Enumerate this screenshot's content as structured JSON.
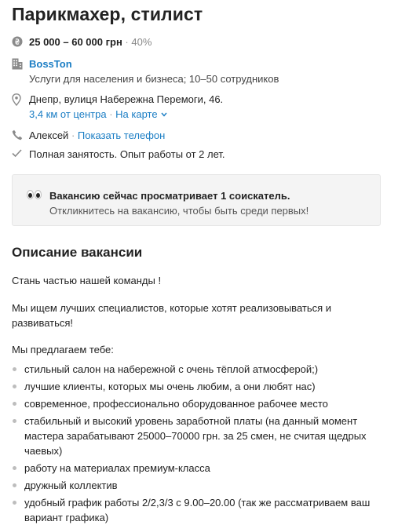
{
  "vacancy": {
    "title": "Парикмахер, стилист",
    "salary": "25 000 – 60 000 грн",
    "salary_separator": "·",
    "salary_percent": "40%",
    "company": {
      "name": "BossTon",
      "description": "Услуги для населения и бизнеса; 10–50 сотрудников"
    },
    "address": {
      "line": "Днепр, вулиця Набережна Перемоги, 46.",
      "distance": "3,4 км от центра",
      "separator": "·",
      "map_link": "На карте"
    },
    "contact": {
      "name": "Алексей",
      "separator": "·",
      "show_phone": "Показать телефон"
    },
    "employment": "Полная занятость. Опыт работы от 2 лет."
  },
  "notice": {
    "title": "Вакансию сейчас просматривает 1 соискатель.",
    "subtitle": "Откликнитесь на вакансию, чтобы быть среди первых!"
  },
  "description": {
    "heading": "Описание вакансии",
    "paragraphs": [
      "Стань частью нашей команды !",
      "Мы ищем лучших специалистов, которые хотят реализовываться и развиваться!",
      "Мы предлагаем тебе:"
    ],
    "bullets": [
      "стильный салон на набережной с очень тёплой атмосферой;)",
      "лучшие клиенты, которых мы очень любим, а они любят нас)",
      "современное, профессионально оборудованное рабочее место",
      "стабильный и высокий уровень заработной платы (на данный момент мастера зарабатывают 25000–70000 грн. за 25 смен, не считая щедрых чаевых)",
      "работу на материалах премиум-класса",
      "дружный коллектив",
      "удобный график работы 2/2,3/3 с 9.00–20.00 (так же рассматриваем ваш вариант графика)"
    ]
  },
  "icons": {
    "salary": "hryvnia-coin-icon",
    "company": "building-icon",
    "address": "map-pin-icon",
    "map_toggle": "chevron-down-icon",
    "contact": "phone-icon",
    "employment": "checkmark-icon",
    "notice": "eyes-icon"
  },
  "colors": {
    "link": "#1a7dc4",
    "text": "#222222",
    "muted": "#888888",
    "notice_bg": "#f4f4f4"
  }
}
